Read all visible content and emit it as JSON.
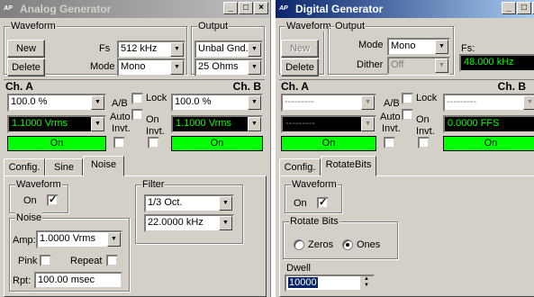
{
  "analog": {
    "title": "Analog Generator",
    "waveform_group": "Waveform",
    "new_label": "New",
    "delete_label": "Delete",
    "fs_label": "Fs",
    "fs_value": "512 kHz",
    "mode_label": "Mode",
    "mode_value": "Mono",
    "output_group": "Output",
    "output_value": "Unbal Gnd.",
    "impedance_value": "25 Ohms",
    "cha_label": "Ch. A",
    "chb_label": "Ch. B",
    "cha_level": "100.0 %",
    "chb_level": "100.0 %",
    "ab_label": "A/B",
    "lock_label": "Lock",
    "auto_label": "Auto",
    "invt_label": "Invt.",
    "on_label": "On",
    "cha_amp": "1.1000 Vrms",
    "chb_amp": "1.1000 Vrms",
    "cha_on": "On",
    "chb_on": "On",
    "tabs": [
      "Config.",
      "Sine",
      "Noise"
    ],
    "wave_group": "Waveform",
    "wave_on": "On",
    "noise_group": "Noise",
    "amp_label": "Amp:",
    "amp_value": "1.0000 Vrms",
    "pink_label": "Pink",
    "repeat_label": "Repeat",
    "rpt_label": "Rpt:",
    "rpt_value": "100.00 msec",
    "filter_group": "Filter",
    "filter_value": "1/3 Oct.",
    "freq_value": "22.0000 kHz",
    "check_mark": "✓"
  },
  "digital": {
    "title": "Digital Generator",
    "waveform_group": "Waveform",
    "new_label": "New",
    "delete_label": "Delete",
    "output_group": "Output",
    "mode_label": "Mode",
    "mode_value": "Mono",
    "dither_label": "Dither",
    "dither_value": "Off",
    "fs_label": "Fs:",
    "fs_value": "48.000 kHz",
    "cha_label": "Ch. A",
    "chb_label": "Ch. B",
    "cha_level": "---------",
    "chb_level": "---------",
    "ab_label": "A/B",
    "lock_label": "Lock",
    "auto_label": "Auto",
    "invt_label": "Invt.",
    "on_label": "On",
    "cha_amp": "---------",
    "chb_amp": "0.0000 FFS",
    "cha_on": "On",
    "chb_on": "On",
    "tabs": [
      "Config.",
      "RotateBits"
    ],
    "wave_group": "Waveform",
    "wave_on": "On",
    "rotate_group": "Rotate Bits",
    "zeros_label": "Zeros",
    "ones_label": "Ones",
    "dwell_label": "Dwell",
    "dwell_value": "10000",
    "check_mark": "✓"
  },
  "window_buttons": {
    "minimize": "_",
    "maximize": "□",
    "close": "×"
  },
  "colors": {
    "active_title": "#0a246a",
    "display_green": "#00ff00",
    "window_bg": "#d4d0c8"
  }
}
